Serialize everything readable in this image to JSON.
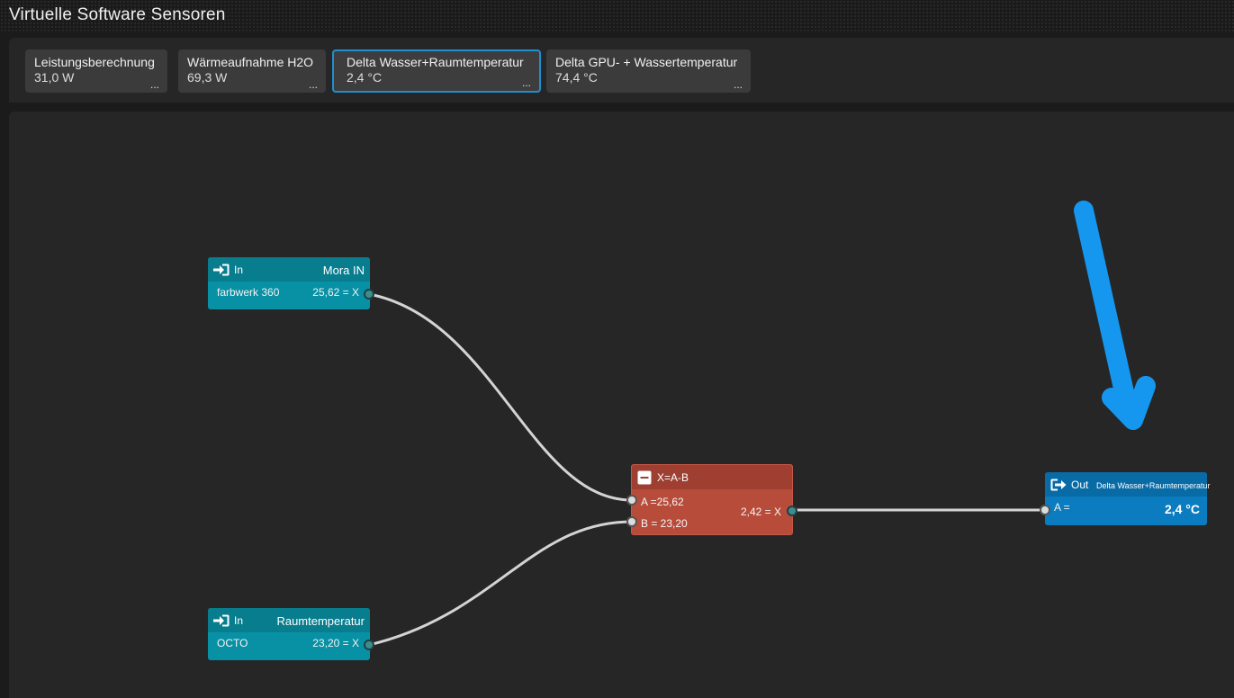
{
  "window": {
    "title": "Virtuelle Software Sensoren"
  },
  "sensors": [
    {
      "name": "Leistungsberechnung",
      "value": "31,0 W",
      "more": "..."
    },
    {
      "name": "Wärmeaufnahme H2O",
      "value": "69,3 W",
      "more": "..."
    },
    {
      "name": "Delta Wasser+Raumtemperatur",
      "value": "2,4 °C",
      "more": "..."
    },
    {
      "name": "Delta GPU-  + Wassertemperatur",
      "value": "74,4 °C",
      "more": "..."
    }
  ],
  "nodes": {
    "input1": {
      "type_label": "In",
      "name": "Mora IN",
      "source": "farbwerk 360",
      "value": "25,62 = X"
    },
    "input2": {
      "type_label": "In",
      "name": "Raumtemperatur",
      "source": "OCTO",
      "value": "23,20 = X"
    },
    "operation": {
      "formula": "X=A-B",
      "a": "A  =25,62",
      "b": "B  = 23,20",
      "result": "2,42 = X"
    },
    "output": {
      "type_label": "Out",
      "name": "Delta Wasser+Raumtemperatur",
      "input": "A =",
      "value": "2,4 °C"
    }
  },
  "colors": {
    "accent": "#1f8fd0",
    "input_node": "#0891a5",
    "operation_node": "#b84c3b",
    "output_node": "#0a7cbf",
    "annotation_arrow": "#1697ef"
  },
  "icons": {
    "in": "sign-in-icon",
    "out": "sign-out-icon",
    "minus": "minus-square-icon"
  }
}
